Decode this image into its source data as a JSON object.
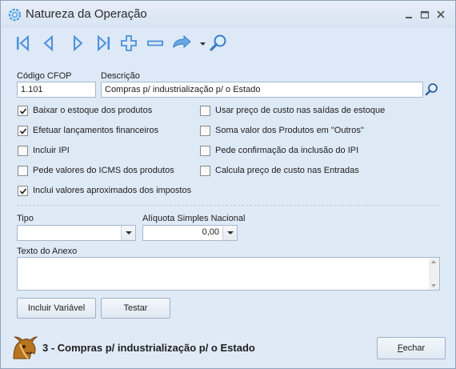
{
  "window": {
    "title": "Natureza da Operação"
  },
  "toolbar": {
    "icons": [
      "first-record-icon",
      "previous-record-icon",
      "next-record-icon",
      "last-record-icon",
      "add-icon",
      "remove-icon",
      "undo-icon",
      "search-icon"
    ]
  },
  "form": {
    "cfop_label": "Código CFOP",
    "cfop_value": "1.101",
    "descricao_label": "Descrição",
    "descricao_value": "Compras p/ industrialização p/ o Estado",
    "checkboxes_left": [
      {
        "label": "Baixar o estoque dos produtos",
        "checked": true
      },
      {
        "label": "Efetuar lançamentos financeiros",
        "checked": true
      },
      {
        "label": "Incluir IPI",
        "checked": false
      },
      {
        "label": "Pede valores do ICMS dos produtos",
        "checked": false
      },
      {
        "label": "Inclui valores aproximados dos impostos",
        "checked": true
      }
    ],
    "checkboxes_right": [
      {
        "label": "Usar preço de custo nas saídas de estoque",
        "checked": false
      },
      {
        "label": "Soma valor dos Produtos em \"Outros\"",
        "checked": false
      },
      {
        "label": "Pede confirmação da inclusão do IPI",
        "checked": false
      },
      {
        "label": "Calcula preço de custo nas Entradas",
        "checked": false
      }
    ],
    "tipo_label": "Tipo",
    "tipo_value": "",
    "aliquota_label": "Alíquota Simples Nacional",
    "aliquota_value": "0,00",
    "texto_anexo_label": "Texto do Anexo",
    "texto_anexo_value": ""
  },
  "buttons": {
    "incluir_variavel": "Incluir Variável",
    "testar": "Testar",
    "fechar": "Fechar"
  },
  "footer": {
    "status": "3 - Compras p/ industrialização p/ o Estado"
  },
  "colors": {
    "accent": "#3a78c9",
    "window_bg": "#dfeaf6"
  }
}
